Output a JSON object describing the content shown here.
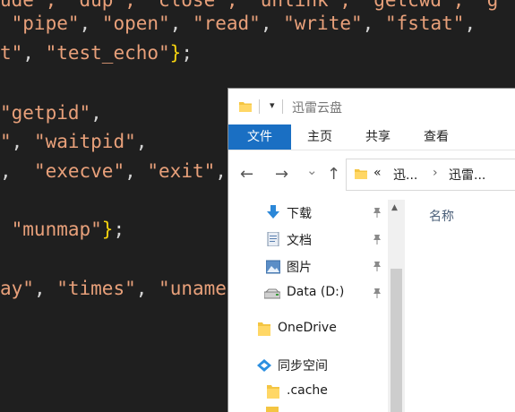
{
  "editor": {
    "lines": [
      [
        [
          "tok",
          "ude\", \"dup\", \"close\", \"unlink\", \"getcwd\", \"g"
        ]
      ],
      [
        [
          "tok",
          " \"pipe\""
        ],
        [
          "punc",
          ", "
        ],
        [
          "tok",
          "\"open\""
        ],
        [
          "punc",
          ", "
        ],
        [
          "tok",
          "\"read\""
        ],
        [
          "punc",
          ", "
        ],
        [
          "tok",
          "\"write\""
        ],
        [
          "punc",
          ", "
        ],
        [
          "tok",
          "\"fstat\""
        ],
        [
          "punc",
          ","
        ]
      ],
      [
        [
          "tok",
          "t\""
        ],
        [
          "punc",
          ", "
        ],
        [
          "tok",
          "\"test_echo\""
        ],
        [
          "brace",
          "}"
        ],
        [
          "semi",
          ";"
        ]
      ],
      [
        [
          "tok",
          ""
        ]
      ],
      [
        [
          "tok",
          "\"getpid\""
        ],
        [
          "punc",
          ","
        ]
      ],
      [
        [
          "tok",
          "\""
        ],
        [
          "punc",
          ", "
        ],
        [
          "tok",
          "\"waitpid\""
        ],
        [
          "punc",
          ","
        ]
      ],
      [
        [
          "punc",
          ",  "
        ],
        [
          "tok",
          "\"execve\""
        ],
        [
          "punc",
          ", "
        ],
        [
          "tok",
          "\"exit\""
        ],
        [
          "punc",
          ","
        ]
      ],
      [
        [
          "tok",
          ""
        ]
      ],
      [
        [
          "tok",
          " \"munmap\""
        ],
        [
          "brace",
          "}"
        ],
        [
          "semi",
          ";"
        ]
      ],
      [
        [
          "tok",
          ""
        ]
      ],
      [
        [
          "tok",
          "ay\""
        ],
        [
          "punc",
          ", "
        ],
        [
          "tok",
          "\"times\""
        ],
        [
          "punc",
          ", "
        ],
        [
          "tok",
          "\"uname\""
        ]
      ]
    ],
    "colors": {
      "string": "#e8a07a",
      "punctuation": "#d4d4d4",
      "brace": "#f5d20f",
      "background": "#1f1f1f"
    }
  },
  "explorer": {
    "title": "迅雷云盘",
    "tabs": [
      "文件",
      "主页",
      "共享",
      "查看"
    ],
    "active_tab": "文件",
    "accent": "#1a6fc3",
    "address": {
      "sep": "«",
      "crumb1": "迅...",
      "arrow": "›",
      "crumb2": "迅雷..."
    },
    "nav": {
      "back": "←",
      "forward": "→",
      "recent": "⌄",
      "up": "↑"
    },
    "sidebar": [
      {
        "label": "下载",
        "icon": "download-icon",
        "pinned": true
      },
      {
        "label": "文档",
        "icon": "document-icon",
        "pinned": true
      },
      {
        "label": "图片",
        "icon": "picture-icon",
        "pinned": true
      },
      {
        "label": "Data (D:)",
        "icon": "drive-icon",
        "pinned": true
      },
      {
        "label": "OneDrive",
        "icon": "folder-icon",
        "pinned": false
      },
      {
        "label": "同步空间",
        "icon": "sync-space-icon",
        "pinned": false
      },
      {
        "label": ".cache",
        "icon": "folder-icon",
        "pinned": false
      }
    ],
    "column_header": "名称"
  }
}
